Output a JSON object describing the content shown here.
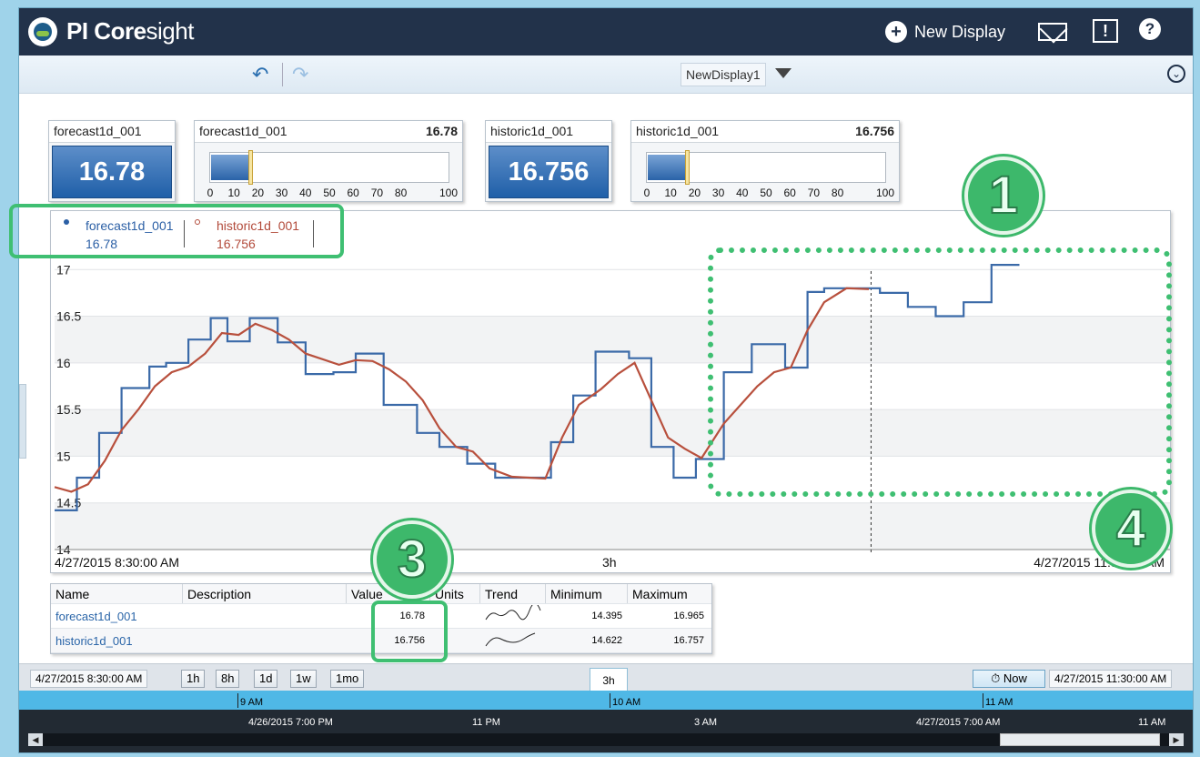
{
  "app": {
    "brand_bold": "PI Core",
    "brand_light": "sight"
  },
  "header": {
    "new_display_label": "New Display"
  },
  "toolbar": {
    "display_name": "NewDisplay1"
  },
  "tiles": [
    {
      "name": "forecast1d_001",
      "value": "16.78",
      "kind": "value"
    },
    {
      "name": "forecast1d_001",
      "value": "16.78",
      "kind": "gauge",
      "fraction": 0.1678
    },
    {
      "name": "historic1d_001",
      "value": "16.756",
      "kind": "value"
    },
    {
      "name": "historic1d_001",
      "value": "16.756",
      "kind": "gauge",
      "fraction": 0.16756
    }
  ],
  "gauge_scale": [
    "0",
    "10",
    "20",
    "30",
    "40",
    "50",
    "60",
    "70",
    "80",
    "100"
  ],
  "legend": [
    {
      "name": "forecast1d_001",
      "value": "16.78",
      "color": "#2b5fa5"
    },
    {
      "name": "historic1d_001",
      "value": "16.756",
      "color": "#b24a3a"
    }
  ],
  "trend": {
    "start": "4/27/2015 8:30:00 AM",
    "duration": "3h",
    "end": "4/27/2015 11:30:00 AM"
  },
  "chart_data": {
    "type": "line",
    "x_range": [
      "4/27/2015 8:30:00 AM",
      "4/27/2015 11:30:00 AM"
    ],
    "yticks": [
      14,
      14.5,
      15,
      15.5,
      16,
      16.5,
      17
    ],
    "ylim": [
      14,
      17.1
    ],
    "series": [
      {
        "name": "forecast1d_001",
        "color": "#3b6aa8",
        "step": true,
        "points": [
          [
            0,
            14.42
          ],
          [
            0.02,
            14.42
          ],
          [
            0.02,
            14.77
          ],
          [
            0.04,
            14.77
          ],
          [
            0.04,
            15.25
          ],
          [
            0.06,
            15.25
          ],
          [
            0.06,
            15.73
          ],
          [
            0.085,
            15.73
          ],
          [
            0.085,
            15.96
          ],
          [
            0.1,
            15.96
          ],
          [
            0.1,
            16.0
          ],
          [
            0.12,
            16.0
          ],
          [
            0.12,
            16.25
          ],
          [
            0.14,
            16.25
          ],
          [
            0.14,
            16.48
          ],
          [
            0.155,
            16.48
          ],
          [
            0.155,
            16.23
          ],
          [
            0.175,
            16.23
          ],
          [
            0.175,
            16.48
          ],
          [
            0.2,
            16.48
          ],
          [
            0.2,
            16.22
          ],
          [
            0.225,
            16.22
          ],
          [
            0.225,
            15.88
          ],
          [
            0.25,
            15.88
          ],
          [
            0.25,
            15.9
          ],
          [
            0.27,
            15.9
          ],
          [
            0.27,
            16.1
          ],
          [
            0.295,
            16.1
          ],
          [
            0.295,
            15.55
          ],
          [
            0.325,
            15.55
          ],
          [
            0.325,
            15.25
          ],
          [
            0.345,
            15.25
          ],
          [
            0.345,
            15.1
          ],
          [
            0.37,
            15.1
          ],
          [
            0.37,
            14.92
          ],
          [
            0.395,
            14.92
          ],
          [
            0.395,
            14.77
          ],
          [
            0.44,
            14.77
          ],
          [
            0.44,
            14.77
          ],
          [
            0.445,
            14.77
          ],
          [
            0.445,
            15.15
          ],
          [
            0.465,
            15.15
          ],
          [
            0.465,
            15.65
          ],
          [
            0.485,
            15.65
          ],
          [
            0.485,
            16.12
          ],
          [
            0.515,
            16.12
          ],
          [
            0.515,
            16.05
          ],
          [
            0.535,
            16.05
          ],
          [
            0.535,
            15.1
          ],
          [
            0.555,
            15.1
          ],
          [
            0.555,
            14.77
          ],
          [
            0.575,
            14.77
          ],
          [
            0.575,
            14.97
          ],
          [
            0.6,
            14.97
          ],
          [
            0.6,
            15.9
          ],
          [
            0.625,
            15.9
          ],
          [
            0.625,
            16.2
          ],
          [
            0.655,
            16.2
          ],
          [
            0.655,
            15.95
          ],
          [
            0.675,
            15.95
          ],
          [
            0.675,
            16.76
          ],
          [
            0.69,
            16.76
          ],
          [
            0.69,
            16.8
          ],
          [
            0.74,
            16.8
          ],
          [
            0.74,
            16.75
          ],
          [
            0.765,
            16.75
          ],
          [
            0.765,
            16.6
          ],
          [
            0.79,
            16.6
          ],
          [
            0.79,
            16.5
          ],
          [
            0.815,
            16.5
          ],
          [
            0.815,
            16.65
          ],
          [
            0.84,
            16.65
          ],
          [
            0.84,
            17.05
          ],
          [
            0.865,
            17.05
          ]
        ]
      },
      {
        "name": "historic1d_001",
        "color": "#b8503d",
        "step": false,
        "points": [
          [
            0,
            14.67
          ],
          [
            0.015,
            14.62
          ],
          [
            0.03,
            14.7
          ],
          [
            0.045,
            14.95
          ],
          [
            0.06,
            15.28
          ],
          [
            0.075,
            15.5
          ],
          [
            0.09,
            15.75
          ],
          [
            0.105,
            15.9
          ],
          [
            0.12,
            15.96
          ],
          [
            0.135,
            16.1
          ],
          [
            0.15,
            16.32
          ],
          [
            0.165,
            16.3
          ],
          [
            0.18,
            16.42
          ],
          [
            0.195,
            16.35
          ],
          [
            0.21,
            16.25
          ],
          [
            0.225,
            16.1
          ],
          [
            0.24,
            16.04
          ],
          [
            0.255,
            15.98
          ],
          [
            0.27,
            16.03
          ],
          [
            0.285,
            16.02
          ],
          [
            0.3,
            15.93
          ],
          [
            0.315,
            15.8
          ],
          [
            0.33,
            15.6
          ],
          [
            0.345,
            15.3
          ],
          [
            0.36,
            15.1
          ],
          [
            0.375,
            15.05
          ],
          [
            0.39,
            14.87
          ],
          [
            0.41,
            14.78
          ],
          [
            0.44,
            14.76
          ],
          [
            0.455,
            15.2
          ],
          [
            0.47,
            15.55
          ],
          [
            0.49,
            15.72
          ],
          [
            0.505,
            15.88
          ],
          [
            0.52,
            16.0
          ],
          [
            0.535,
            15.6
          ],
          [
            0.55,
            15.2
          ],
          [
            0.565,
            15.08
          ],
          [
            0.58,
            14.98
          ],
          [
            0.6,
            15.35
          ],
          [
            0.615,
            15.55
          ],
          [
            0.63,
            15.75
          ],
          [
            0.645,
            15.9
          ],
          [
            0.66,
            15.95
          ],
          [
            0.675,
            16.35
          ],
          [
            0.69,
            16.65
          ],
          [
            0.71,
            16.8
          ],
          [
            0.73,
            16.79
          ]
        ]
      }
    ]
  },
  "table": {
    "headers": [
      "Name",
      "Description",
      "Value",
      "Units",
      "Trend",
      "Minimum",
      "Maximum"
    ],
    "rows": [
      {
        "name": "forecast1d_001",
        "description": "",
        "value": "16.78",
        "units": "",
        "min": "14.395",
        "max": "16.965"
      },
      {
        "name": "historic1d_001",
        "description": "",
        "value": "16.756",
        "units": "",
        "min": "14.622",
        "max": "16.757"
      }
    ]
  },
  "timebar": {
    "start": "4/27/2015 8:30:00 AM",
    "ranges": [
      "1h",
      "8h",
      "1d",
      "1w",
      "1mo"
    ],
    "duration_tab": "3h",
    "now_label": "Now",
    "end": "4/27/2015 11:30:00 AM",
    "ruler": [
      "9 AM",
      "10 AM",
      "11 AM"
    ],
    "overview": [
      "4/26/2015 7:00 PM",
      "11 PM",
      "3 AM",
      "4/27/2015 7:00 AM",
      "11 AM"
    ]
  },
  "annotations": [
    "1",
    "3",
    "4"
  ]
}
